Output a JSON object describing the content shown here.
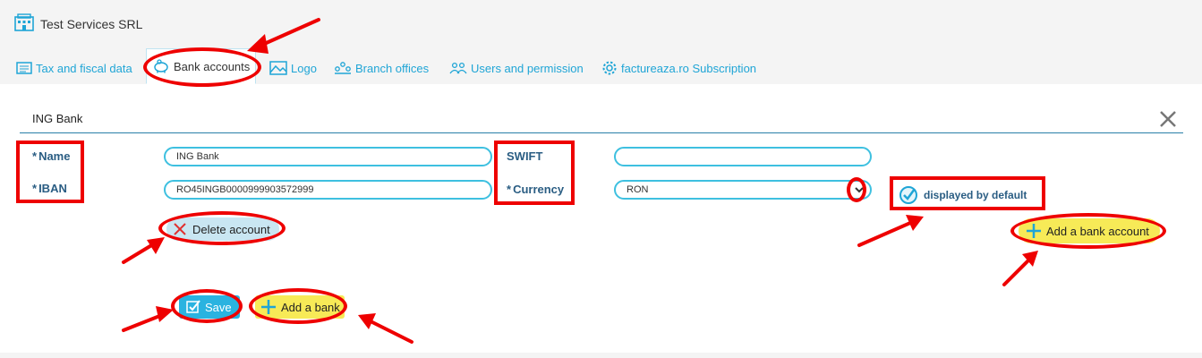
{
  "header": {
    "company_name": "Test Services SRL"
  },
  "tabs": [
    {
      "label": "Tax and fiscal data",
      "icon": "ledger-icon"
    },
    {
      "label": "Bank accounts",
      "icon": "piggy-bank-icon"
    },
    {
      "label": "Logo",
      "icon": "image-icon"
    },
    {
      "label": "Branch offices",
      "icon": "branch-icon"
    },
    {
      "label": "Users and permission",
      "icon": "users-icon"
    },
    {
      "label": "factureaza.ro Subscription",
      "icon": "gear-icon"
    }
  ],
  "account": {
    "title": "ING Bank",
    "name_label": "Name",
    "iban_label": "IBAN",
    "swift_label": "SWIFT",
    "currency_label": "Currency",
    "required_mark": "*",
    "name_value": "ING Bank",
    "iban_value": "RO45INGB0000999903572999",
    "swift_value": "",
    "currency_value": "RON",
    "default_label": "displayed by default"
  },
  "buttons": {
    "delete_account": "Delete account",
    "add_bank_account": "Add a bank account",
    "save": "Save",
    "add_bank": "Add a bank"
  },
  "colors": {
    "accent": "#1fa5d6",
    "label": "#2a5d83",
    "annotation": "#ee0000",
    "highlight": "#f7ea57"
  }
}
